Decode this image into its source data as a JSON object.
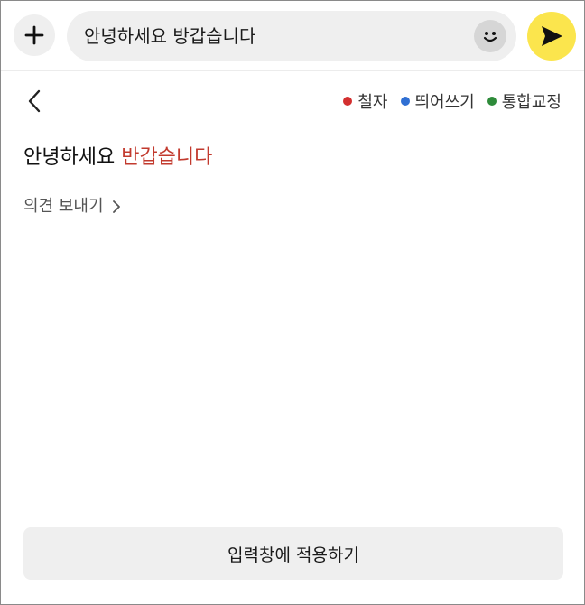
{
  "colors": {
    "send_button_bg": "#fbe54d",
    "spelling": "#d32f2f",
    "spacing": "#2f6fd3",
    "combined": "#2e8b3a",
    "error_text": "#c23a2e"
  },
  "header": {
    "plus_icon": "plus-icon",
    "input": {
      "value": "안녕하세요 방갑습니다",
      "emoji_icon": "smiley-icon"
    },
    "send_icon": "send-icon"
  },
  "toolbar": {
    "back_icon": "chevron-left-icon"
  },
  "legend": {
    "items": [
      {
        "label": "철자",
        "color": "#d32f2f"
      },
      {
        "label": "띄어쓰기",
        "color": "#2f6fd3"
      },
      {
        "label": "통합교정",
        "color": "#2e8b3a"
      }
    ]
  },
  "result": {
    "normal_text": "안녕하세요 ",
    "corrected_text": "반갑습니다"
  },
  "feedback": {
    "label": "의견 보내기"
  },
  "apply": {
    "label": "입력창에 적용하기"
  }
}
